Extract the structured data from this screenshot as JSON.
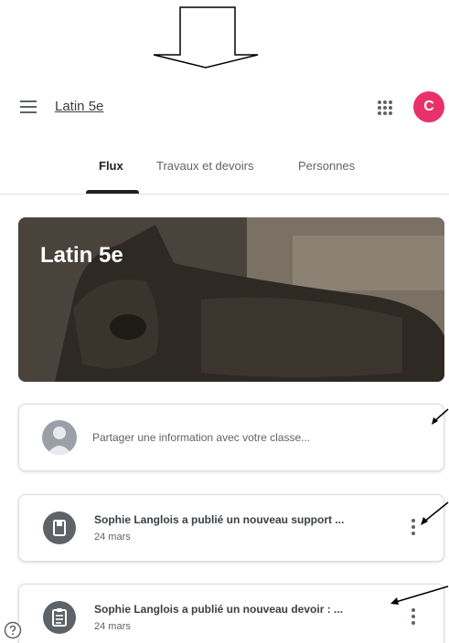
{
  "header": {
    "class_title": "Latin 5e",
    "avatar_letter": "C",
    "avatar_color": "#e8316a"
  },
  "tabs": [
    {
      "label": "Flux",
      "active": true
    },
    {
      "label": "Travaux et devoirs",
      "active": false
    },
    {
      "label": "Personnes",
      "active": false
    }
  ],
  "banner": {
    "title": "Latin 5e"
  },
  "share": {
    "placeholder": "Partager une information avec votre classe..."
  },
  "posts": [
    {
      "title": "Sophie Langlois a publié un nouveau support ...",
      "date": "24 mars",
      "icon": "material-icon"
    },
    {
      "title": "Sophie Langlois a publié un nouveau devoir : ...",
      "date": "24 mars",
      "icon": "assignment-icon"
    }
  ],
  "icons": {
    "menu": "menu-icon",
    "apps": "apps-grid-icon",
    "more": "more-vert-icon",
    "help": "help-icon"
  }
}
